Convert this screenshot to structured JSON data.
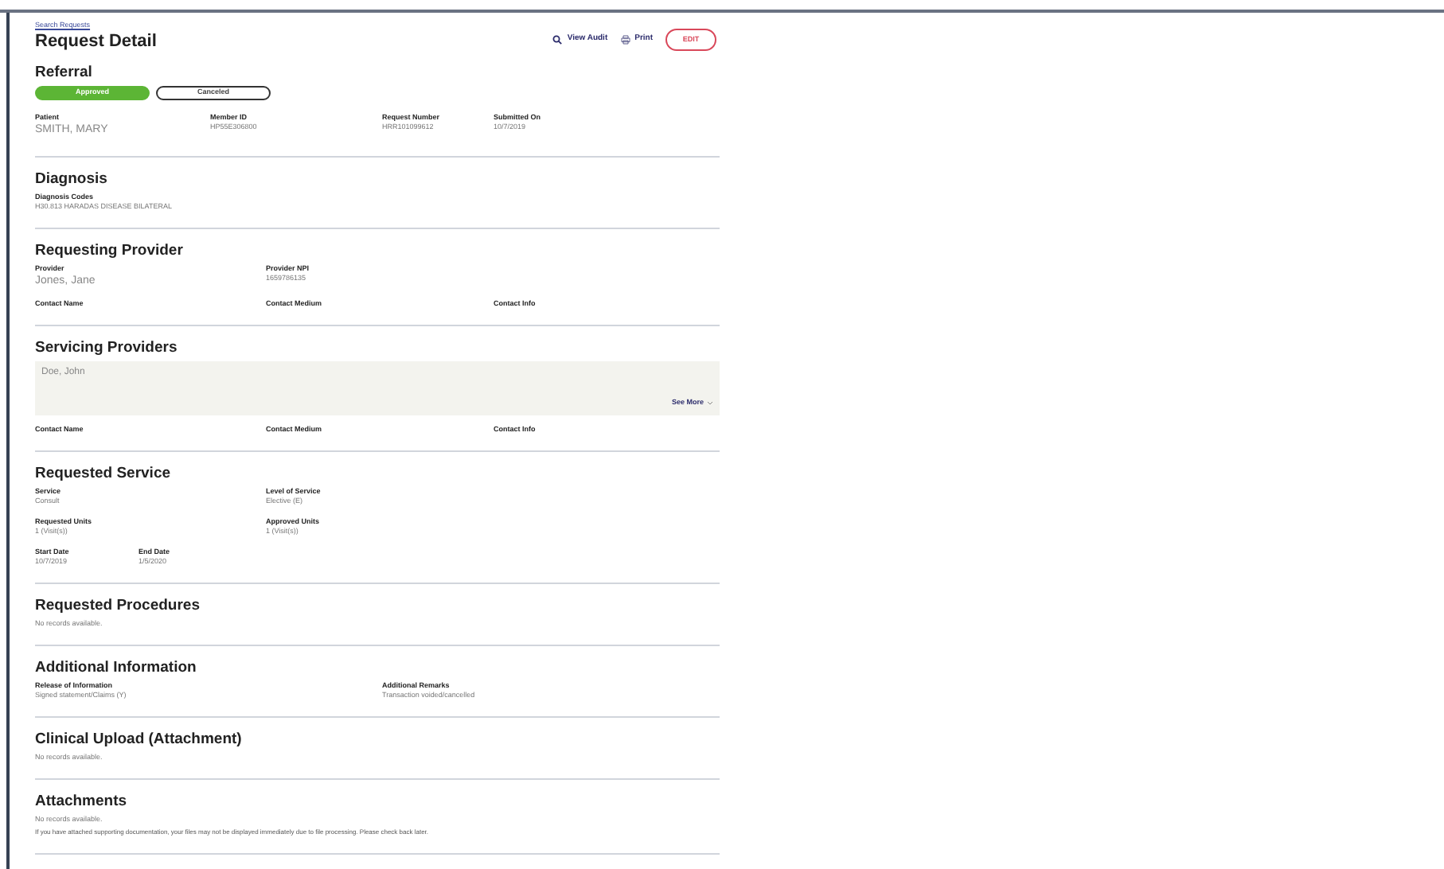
{
  "breadcrumb": "Search Requests",
  "title": "Request Detail",
  "actions": [
    {
      "label": "View Audit",
      "kind": "audit"
    },
    {
      "label": "Print",
      "kind": "print"
    }
  ],
  "edit_button": "EDIT",
  "referral": {
    "heading": "Referral",
    "statuses": [
      {
        "label": "Approved",
        "selected": true
      },
      {
        "label": "Canceled",
        "selected": false
      }
    ],
    "fields": [
      {
        "label": "Patient",
        "value": "SMITH, MARY",
        "kind": "large"
      },
      {
        "label": "Member ID",
        "value": "HP55E306800"
      },
      {
        "label": "Request Number",
        "value": "HRR101099612"
      },
      {
        "label": "Submitted On",
        "value": "10/7/2019"
      }
    ]
  },
  "sections": [
    {
      "heading": "Diagnosis",
      "kind": "fields",
      "rows": [
        [
          {
            "label": "Diagnosis Codes",
            "value": "H30.813 HARADAS DISEASE BILATERAL"
          }
        ]
      ]
    },
    {
      "heading": "Requesting Provider",
      "kind": "fields",
      "rows": [
        [
          {
            "label": "Provider",
            "value": "Jones, Jane",
            "kind": "large"
          },
          {
            "label": "Provider NPI",
            "value": "1659786135"
          }
        ],
        [
          {
            "label": "Contact Name"
          },
          {
            "label": "Contact Medium"
          },
          {
            "label": "Contact Info"
          }
        ]
      ]
    },
    {
      "heading": "Servicing Providers",
      "kind": "panel",
      "panel": {
        "name": "Doe, John",
        "link": "See More"
      },
      "rows": [
        [
          {
            "label": "Contact Name"
          },
          {
            "label": "Contact Medium"
          },
          {
            "label": "Contact Info"
          }
        ]
      ]
    },
    {
      "heading": "Requested Service",
      "kind": "fields",
      "rows": [
        [
          {
            "label": "Service",
            "value": "Consult"
          },
          {
            "label": "Level of Service",
            "value": "Elective (E)"
          }
        ],
        [
          {
            "label": "Requested Units",
            "value": "1 (Visit(s))"
          },
          {
            "label": "Approved Units",
            "value": "1 (Visit(s))"
          }
        ],
        [
          {
            "label": "Start Date",
            "value": "10/7/2019"
          },
          {
            "label": "End Date",
            "value": "1/5/2020"
          }
        ]
      ]
    },
    {
      "heading": "Requested Procedures",
      "kind": "empty",
      "message": "No records available."
    },
    {
      "heading": "Additional Information",
      "kind": "fields",
      "rows": [
        [
          {
            "label": "Release of Information",
            "value": "Signed statement/Claims (Y)"
          },
          {
            "label": "Additional Remarks",
            "value": "Transaction voided/cancelled"
          }
        ]
      ]
    },
    {
      "heading": "Clinical Upload (Attachment)",
      "kind": "empty",
      "message": "No records available."
    },
    {
      "heading": "Attachments",
      "kind": "empty",
      "message": "No records available.",
      "note": "If you have attached supporting documentation, your files may not be displayed immediately due to file processing. Please check back later."
    }
  ]
}
